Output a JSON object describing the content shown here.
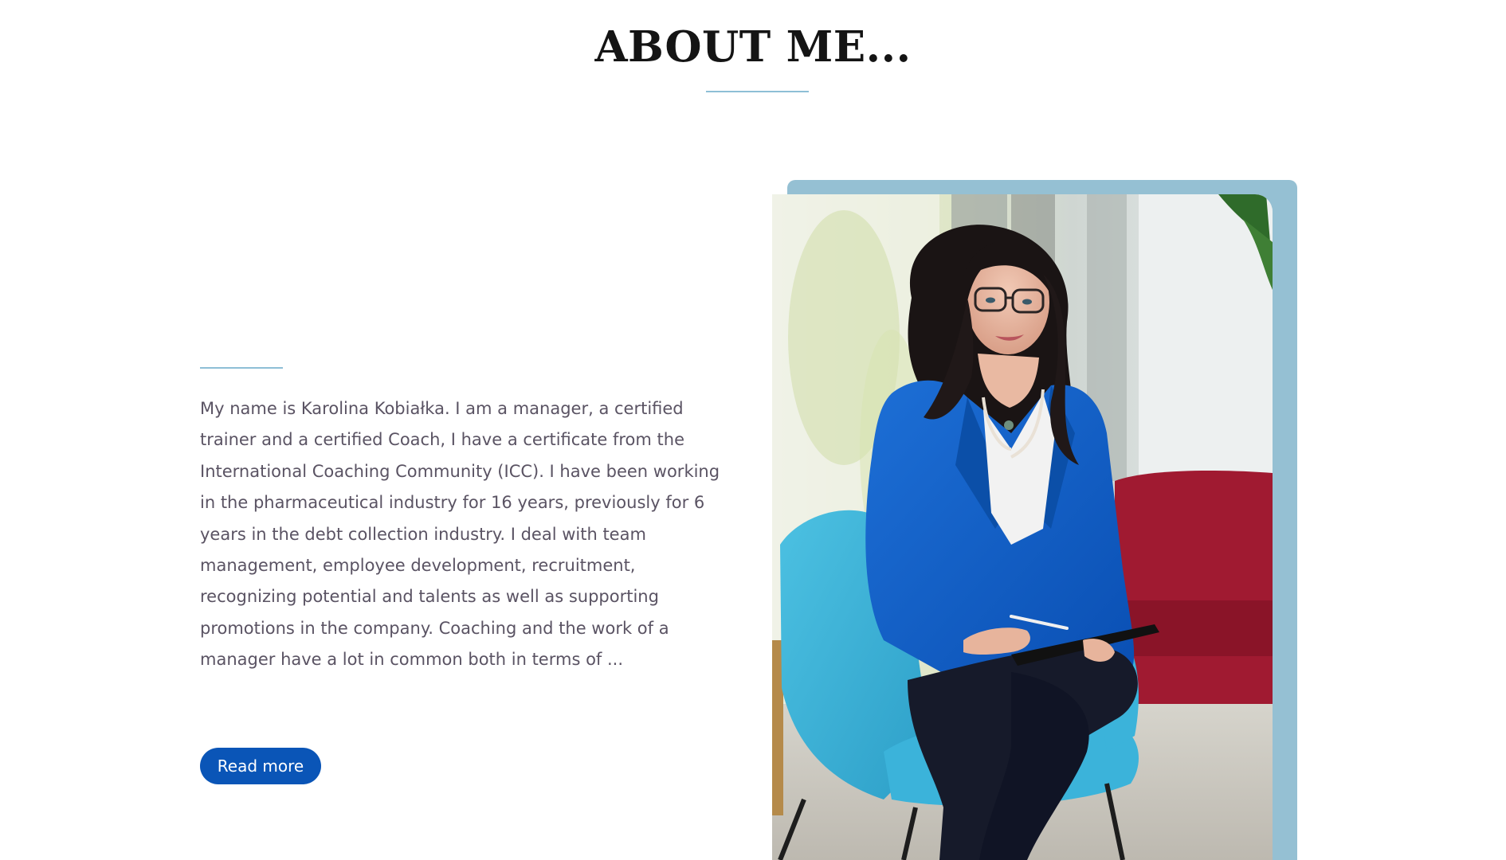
{
  "section": {
    "title": "ABOUT ME..."
  },
  "about": {
    "text": "My name is Karolina Kobiałka. I am a manager, a certified trainer and a certified Coach, I have a certificate from the International Coaching Community (ICC). I have been working in the pharmaceutical industry for 16 years, previously for 6 years in the debt collection industry. I deal with team management, employee development, recruitment, recognizing potential and talents as well as supporting promotions in the company. Coaching and the work of a manager have a lot in common both in terms of ...",
    "read_more_label": "Read more"
  },
  "photo": {
    "alt": "Karolina Kobiałka"
  },
  "colors": {
    "accent": "#8ebfd6",
    "frame": "#95c0d3",
    "button": "#0a55b7",
    "body_text": "#5a5363",
    "title": "#141414"
  }
}
